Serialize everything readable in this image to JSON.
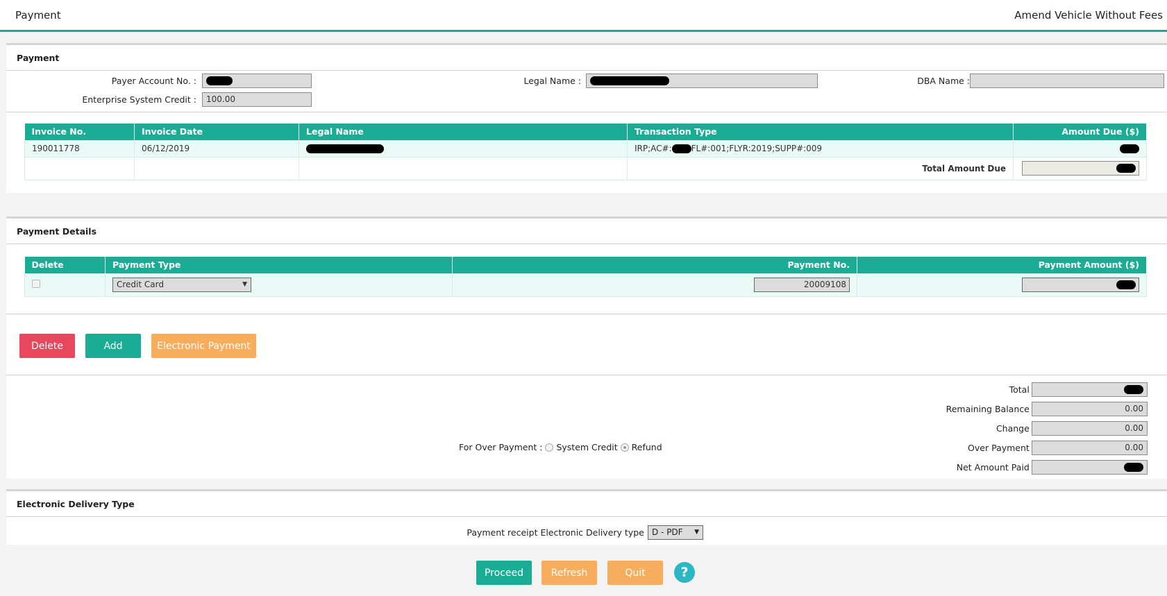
{
  "header": {
    "title": "Payment",
    "subtitle": "Amend Vehicle Without Fees"
  },
  "payment": {
    "title": "Payment",
    "payer_account_label": "Payer Account No. :",
    "legal_name_label": "Legal Name :",
    "dba_name_label": "DBA Name :",
    "credit_label": "Enterprise System Credit :",
    "credit_value": "100.00",
    "invoice_headers": [
      "Invoice No.",
      "Invoice Date",
      "Legal Name",
      "Transaction Type",
      "Amount Due ($)"
    ],
    "invoice_row": {
      "invoice_no": "190011778",
      "invoice_date": "06/12/2019",
      "transaction_prefix": "IRP;AC#:",
      "transaction_suffix": "FL#:001;FLYR:2019;SUPP#:009"
    },
    "total_label": "Total Amount Due"
  },
  "payment_details": {
    "title": "Payment Details",
    "headers": [
      "Delete",
      "Payment Type",
      "Payment No.",
      "Payment Amount ($)"
    ],
    "row": {
      "payment_type": "Credit Card",
      "payment_no": "20009108"
    },
    "buttons": {
      "delete": "Delete",
      "add": "Add",
      "electronic": "Electronic Payment"
    },
    "over_payment_label": "For Over Payment :",
    "radio_system_credit": "System Credit",
    "radio_refund": "Refund",
    "totals": {
      "total_label": "Total :",
      "remaining_label": "Remaining Balance :",
      "remaining_value": "0.00",
      "change_label": "Change :",
      "change_value": "0.00",
      "over_label": "Over Payment :",
      "over_value": "0.00",
      "net_label": "Net Amount Paid :"
    }
  },
  "delivery": {
    "title": "Electronic Delivery Type",
    "label": "Payment receipt Electronic Delivery type :",
    "value": "D - PDF"
  },
  "footer": {
    "proceed": "Proceed",
    "refresh": "Refresh",
    "quit": "Quit",
    "help": "?"
  },
  "colors": {
    "accent": "#1aad95",
    "danger": "#e8485d",
    "warning": "#f7ad5c",
    "help": "#2bb8c4"
  }
}
